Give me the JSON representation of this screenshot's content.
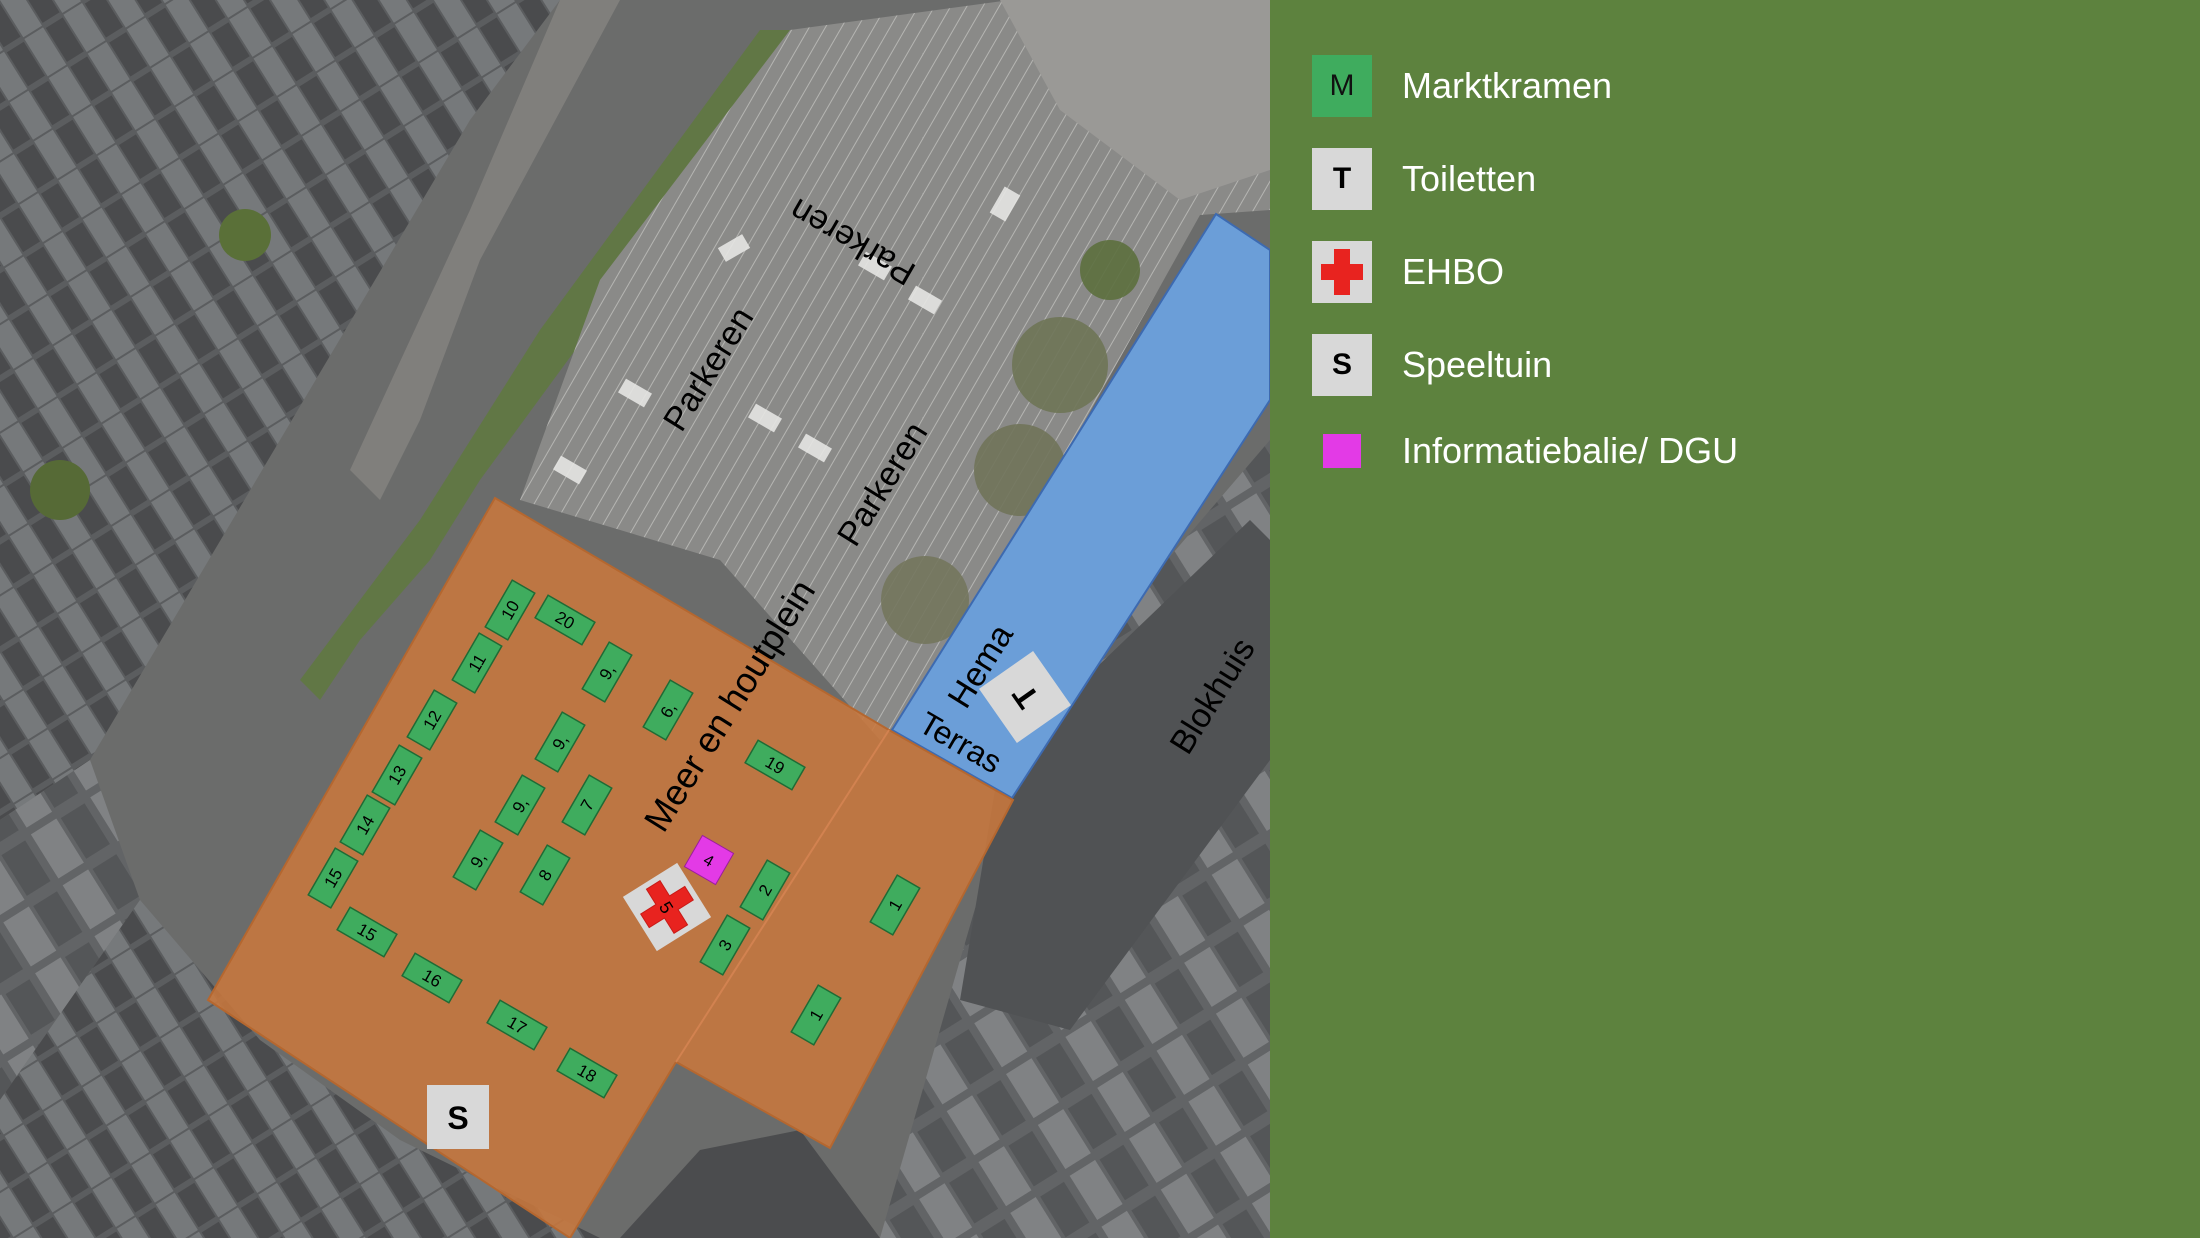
{
  "map": {
    "areas": {
      "parking_labels": [
        "Parkeren",
        "Parkeren",
        "Parkeren"
      ],
      "square_label": "Meer en houtplein",
      "hema_label": "Hema",
      "terras_label": "Terras",
      "blokhuis_label": "Blokhuis",
      "toilet_marker": "T",
      "playground_marker": "S"
    },
    "stalls": [
      "10",
      "20",
      "11",
      "9,",
      "6,",
      "12",
      "9,",
      "19",
      "13",
      "9,",
      "7",
      "14",
      "9,",
      "8",
      "15",
      "2",
      "1",
      "15",
      "16",
      "3",
      "17",
      "1",
      "18"
    ],
    "info_stall": "4",
    "ehbo_stall": "5"
  },
  "legend": {
    "items": [
      {
        "symbol": "M",
        "label": "Marktkramen"
      },
      {
        "symbol": "T",
        "label": "Toiletten"
      },
      {
        "symbol": "",
        "label": "EHBO"
      },
      {
        "symbol": "S",
        "label": "Speeltuin"
      },
      {
        "symbol": "",
        "label": "Informatiebalie/ DGU"
      }
    ]
  },
  "colors": {
    "market_stall": "#3fac5e",
    "event_area": "#c8773d",
    "hema_terrace": "#6b9ed8",
    "info_desk": "#e33ae6",
    "ehbo_cross": "#e8231f",
    "legend_background": "#5d823e"
  }
}
